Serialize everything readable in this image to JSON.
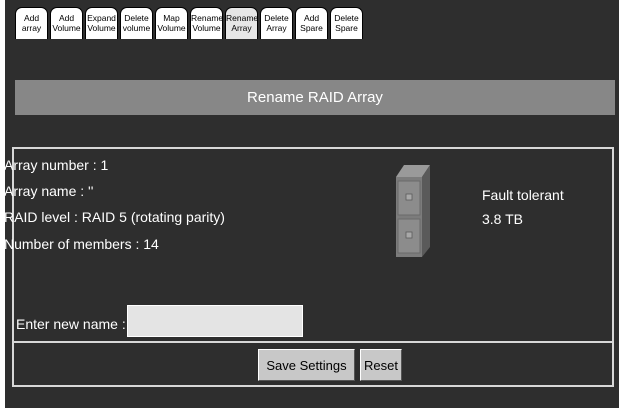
{
  "tabs": [
    {
      "line1": "Add",
      "line2": "array"
    },
    {
      "line1": "Add",
      "line2": "Volume"
    },
    {
      "line1": "Expand",
      "line2": "Volume"
    },
    {
      "line1": "Delete",
      "line2": "volume"
    },
    {
      "line1": "Map",
      "line2": "Volume"
    },
    {
      "line1": "Rename",
      "line2": "Volume"
    },
    {
      "line1": "Rename",
      "line2": "Array"
    },
    {
      "line1": "Delete",
      "line2": "Array"
    },
    {
      "line1": "Add",
      "line2": "Spare"
    },
    {
      "line1": "Delete",
      "line2": "Spare"
    }
  ],
  "page_title": "Rename RAID Array",
  "array_info": {
    "number": "Array number : 1",
    "name": "Array name : ''",
    "raid_level": "RAID level : RAID 5 (rotating parity)",
    "members": "Number of members : 14"
  },
  "status": {
    "state": "Fault tolerant",
    "capacity": "3.8 TB"
  },
  "form": {
    "label": "Enter new name :",
    "value": "",
    "placeholder": ""
  },
  "buttons": {
    "save": "Save Settings",
    "reset": "Reset"
  },
  "icons": {
    "drive": "disk-array-icon"
  }
}
